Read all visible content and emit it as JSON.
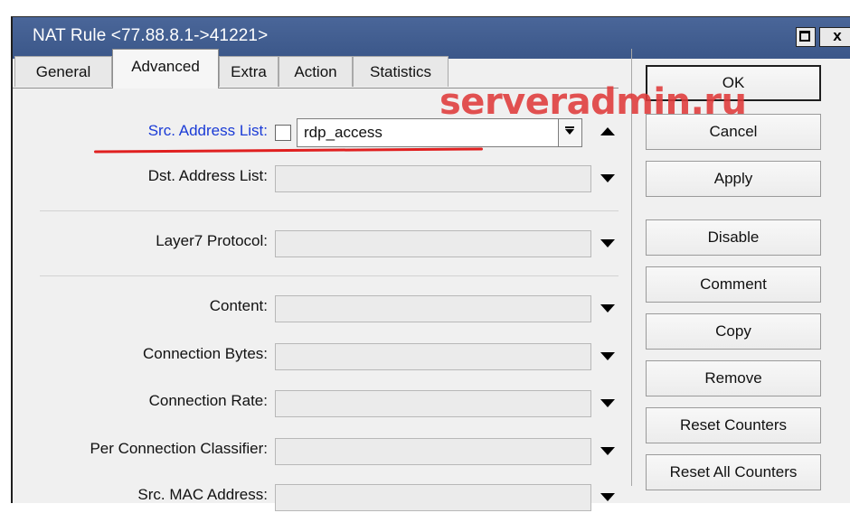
{
  "window": {
    "title": "NAT Rule <77.88.8.1->41221>",
    "controls": {
      "close_label": "x"
    }
  },
  "tabs": [
    {
      "label": "General",
      "active": false
    },
    {
      "label": "Advanced",
      "active": true
    },
    {
      "label": "Extra",
      "active": false
    },
    {
      "label": "Action",
      "active": false
    },
    {
      "label": "Statistics",
      "active": false
    }
  ],
  "fields": {
    "src_address_list": {
      "label": "Src. Address List:",
      "value": "rdp_access",
      "negate_checked": false
    },
    "dst_address_list": {
      "label": "Dst. Address List:",
      "value": ""
    },
    "layer7_protocol": {
      "label": "Layer7 Protocol:",
      "value": ""
    },
    "content": {
      "label": "Content:",
      "value": ""
    },
    "connection_bytes": {
      "label": "Connection Bytes:",
      "value": ""
    },
    "connection_rate": {
      "label": "Connection Rate:",
      "value": ""
    },
    "per_connection_classifier": {
      "label": "Per Connection Classifier:",
      "value": ""
    },
    "src_mac_address": {
      "label": "Src. MAC Address:",
      "value": ""
    }
  },
  "buttons": {
    "ok": "OK",
    "cancel": "Cancel",
    "apply": "Apply",
    "disable": "Disable",
    "comment": "Comment",
    "copy": "Copy",
    "remove": "Remove",
    "reset_counters": "Reset Counters",
    "reset_all_counters": "Reset All Counters"
  },
  "watermark": "serveradmin.ru",
  "colors": {
    "titlebar": "#3b5789",
    "highlight_label": "#1a3bd6",
    "annotation_red": "#e02020"
  }
}
